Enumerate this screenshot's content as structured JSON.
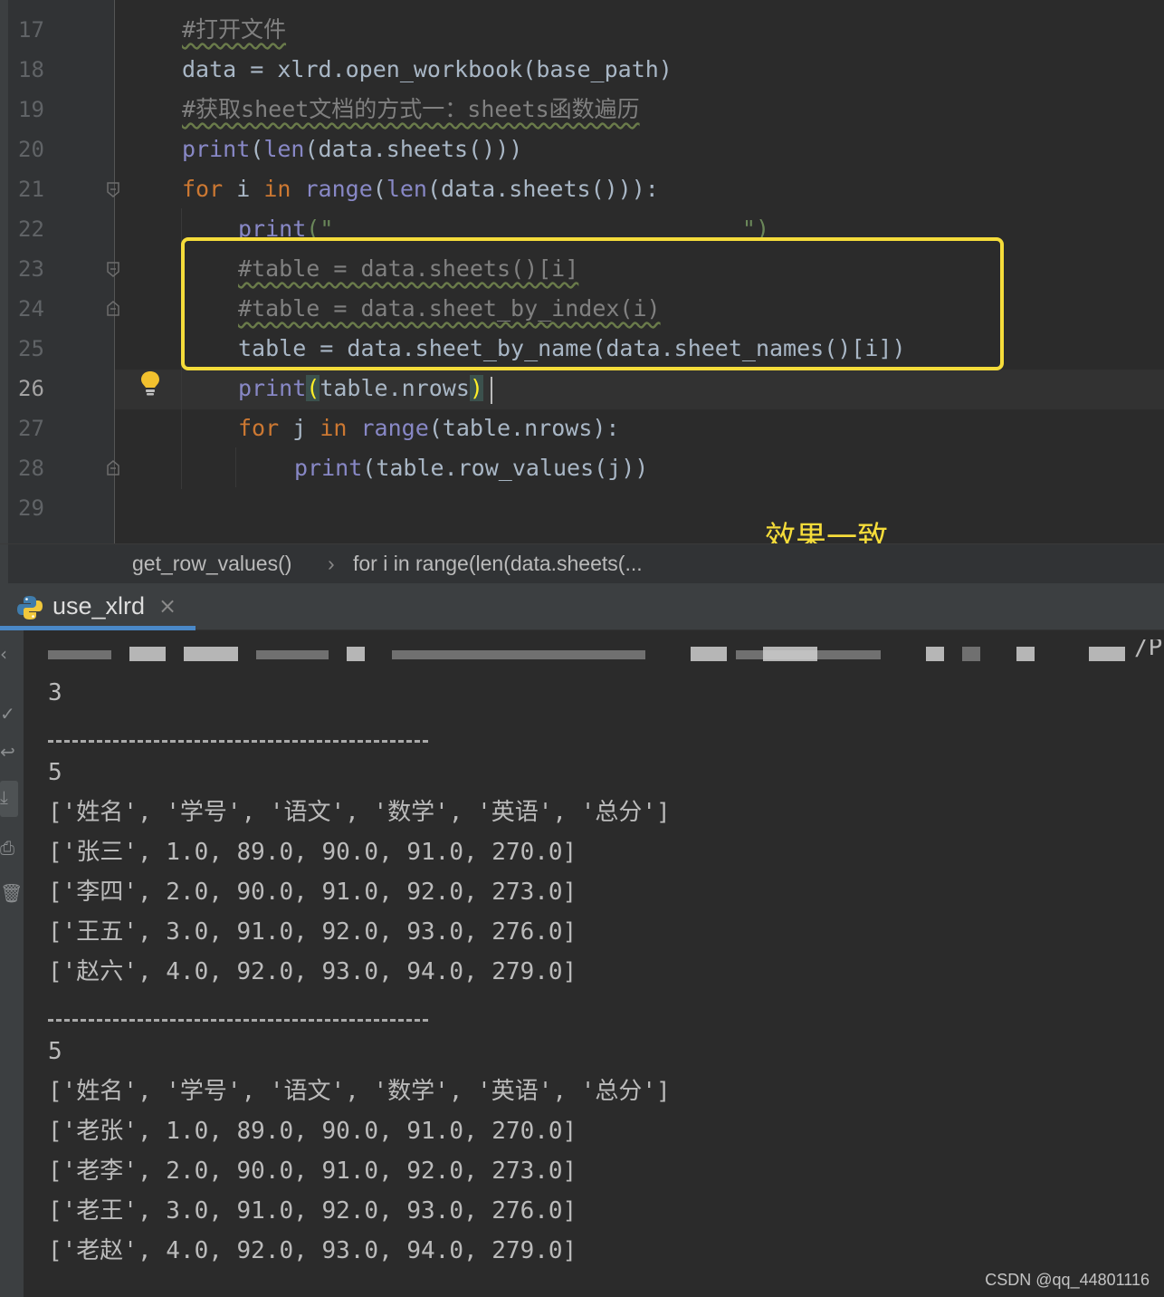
{
  "editor": {
    "line_numbers": [
      "17",
      "18",
      "19",
      "20",
      "21",
      "22",
      "23",
      "24",
      "25",
      "26",
      "27",
      "28",
      "29"
    ],
    "current_line": "26",
    "caption": "效果一致"
  },
  "code": {
    "l17": "#打开文件",
    "l18": "data = xlrd.open_workbook(base_path)",
    "l19": "#获取sheet文档的方式一：sheets函数遍历",
    "l20_print": "print",
    "l20_len": "len",
    "l20_rest": "(data.sheets()))",
    "l21_for": "for",
    "l21_i": " i ",
    "l21_in": "in",
    "l21_range": "range",
    "l21_len": "len",
    "l21_rest": "(data.sheets())):",
    "l22_print": "print",
    "l22_rest": "(\"                              \")",
    "l23": "#table = data.sheets()[i]",
    "l24": "#table = data.sheet_by_index(i)",
    "l25": "table = data.sheet_by_name(data.sheet_names()[i])",
    "l26_print": "print",
    "l26_open": "(",
    "l26_mid": "table.nrows",
    "l26_close": ")",
    "l27_for": "for",
    "l27_j": " j ",
    "l27_in": "in",
    "l27_range": "range",
    "l27_rest": "(table.nrows):",
    "l28_print": "print",
    "l28_rest": "(table.row_values(j))"
  },
  "breadcrumb": {
    "item1": "get_row_values()",
    "separator": "›",
    "item2": "for i in range(len(data.sheets(..."
  },
  "run_window": {
    "tab_label": "use_xlrd",
    "tab_close": "×",
    "path_tail": "/P"
  },
  "console": {
    "sheet_count": "3",
    "block1": {
      "rows_count": "5",
      "rows": [
        "['姓名', '学号', '语文', '数学', '英语', '总分']",
        "['张三', 1.0, 89.0, 90.0, 91.0, 270.0]",
        "['李四', 2.0, 90.0, 91.0, 92.0, 273.0]",
        "['王五', 3.0, 91.0, 92.0, 93.0, 276.0]",
        "['赵六', 4.0, 92.0, 93.0, 94.0, 279.0]"
      ]
    },
    "block2": {
      "rows_count": "5",
      "rows": [
        "['姓名', '学号', '语文', '数学', '英语', '总分']",
        "['老张', 1.0, 89.0, 90.0, 91.0, 270.0]",
        "['老李', 2.0, 90.0, 91.0, 92.0, 273.0]",
        "['老王', 3.0, 91.0, 92.0, 93.0, 276.0]",
        "['老赵', 4.0, 92.0, 93.0, 94.0, 279.0]"
      ]
    }
  },
  "watermark": "CSDN @qq_44801116",
  "colors": {
    "highlight_box": "#f5dc3a",
    "keyword": "#cc7832",
    "builtin": "#8888c6",
    "comment": "#808080",
    "run_tab_underline": "#4a88c7"
  }
}
